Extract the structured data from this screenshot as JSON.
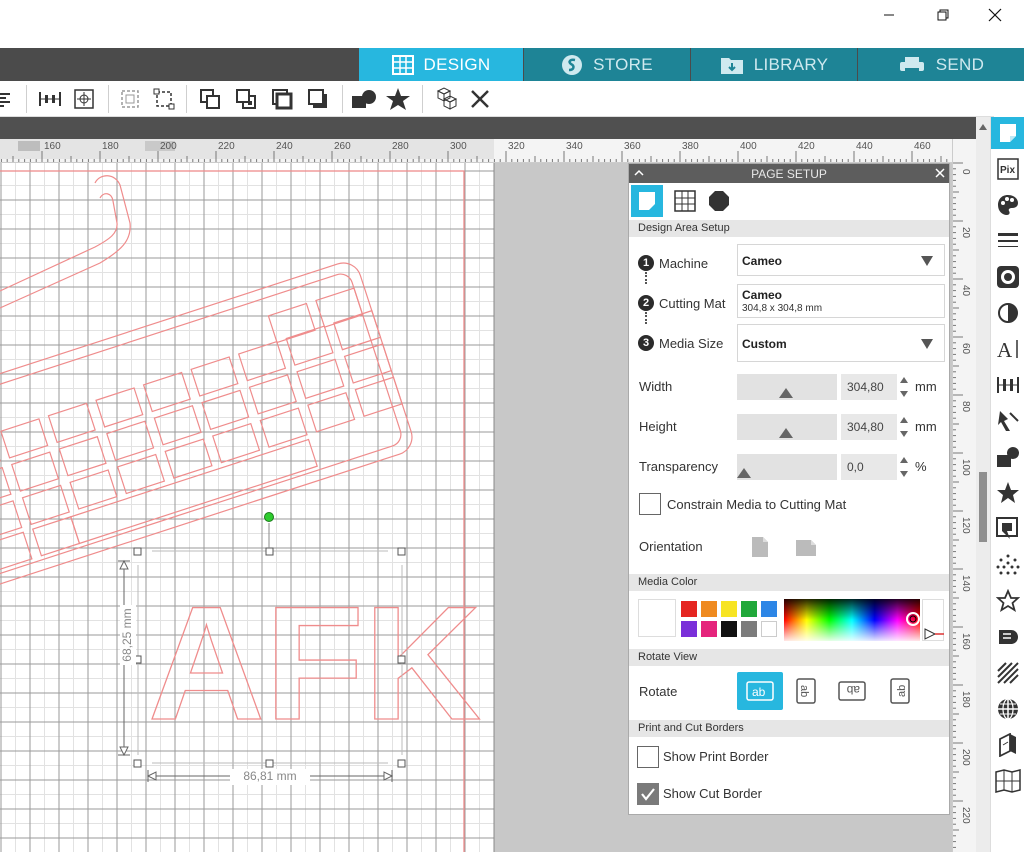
{
  "window": {
    "minimize_icon": "minimize-icon",
    "restore_icon": "restore-icon",
    "close_icon": "close-icon"
  },
  "tabs": [
    {
      "label": "DESIGN",
      "icon": "grid-icon",
      "active": true
    },
    {
      "label": "STORE",
      "icon": "s-logo-icon",
      "active": false
    },
    {
      "label": "LIBRARY",
      "icon": "folder-download-icon",
      "active": false
    },
    {
      "label": "SEND",
      "icon": "printer-icon",
      "active": false
    }
  ],
  "rulers": {
    "horizontal": [
      "160",
      "180",
      "200",
      "220",
      "240",
      "260",
      "280",
      "300",
      "320",
      "340",
      "360",
      "380",
      "400",
      "420",
      "440",
      "460"
    ],
    "vertical": [
      "0",
      "20",
      "40",
      "60",
      "80",
      "100",
      "120",
      "140",
      "160",
      "180",
      "200",
      "220"
    ]
  },
  "canvas": {
    "text_object": "AFK",
    "height_dim": "68,25 mm",
    "width_dim": "86,81 mm"
  },
  "panel": {
    "title": "PAGE SETUP",
    "section_design": "Design Area Setup",
    "machine_label": "Machine",
    "machine_value": "Cameo",
    "cutting_mat_label": "Cutting Mat",
    "cutting_mat_value": "Cameo",
    "cutting_mat_size": "304,8 x 304,8 mm",
    "media_size_label": "Media Size",
    "media_size_value": "Custom",
    "width_label": "Width",
    "width_value": "304,80",
    "width_unit": "mm",
    "height_label": "Height",
    "height_value": "304,80",
    "height_unit": "mm",
    "transparency_label": "Transparency",
    "transparency_value": "0,0",
    "transparency_unit": "%",
    "constrain_label": "Constrain Media to Cutting Mat",
    "orientation_label": "Orientation",
    "section_media_color": "Media Color",
    "section_rotate": "Rotate View",
    "rotate_label": "Rotate",
    "section_borders": "Print and Cut Borders",
    "show_print_border": "Show Print Border",
    "show_cut_border": "Show Cut Border",
    "step1": "1",
    "step2": "2",
    "step3": "3",
    "rotate_icon_text": "ab",
    "swatches": [
      "#e52521",
      "#ef8a1f",
      "#f7e423",
      "#21a83a",
      "#2d86e6",
      "#7a2fd9",
      "#e5247c",
      "#111111",
      "#7c7c7c",
      "#ffffff"
    ],
    "show_print_border_checked": false,
    "show_cut_border_checked": true,
    "constrain_checked": false
  },
  "colors": {
    "accent": "#27b7df",
    "tab_inactive": "#1e8496",
    "design_line": "#ef8c8c"
  }
}
